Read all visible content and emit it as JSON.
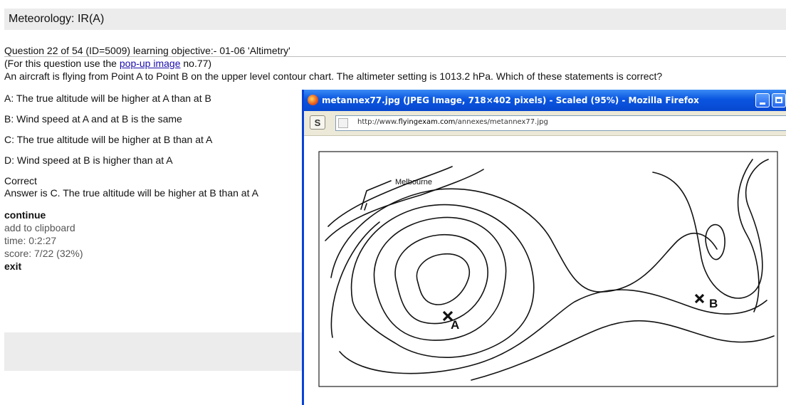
{
  "header": {
    "title": "Meteorology: IR(A)"
  },
  "question": {
    "meta": "Question 22 of 54 (ID=5009) learning objective:- 01-06 'Altimetry'",
    "popup_prefix": "(For this question use the ",
    "popup_link": "pop-up image",
    "popup_suffix": " no.77)",
    "text": "An aircraft is flying from Point A to Point B on the upper level contour chart. The altimeter setting is 1013.2 hPa. Which of these statements is correct?"
  },
  "answers": [
    "A: The true altitude will be higher at A than at B",
    "B: Wind speed at A and at B is the same",
    "C: The true altitude will be higher at B than at A",
    "D: Wind speed at B is higher than at A"
  ],
  "result": {
    "status": "Correct",
    "answer": "Answer is C. The true altitude will be higher at B than at A"
  },
  "controls": {
    "continue": "continue",
    "clipboard": "add to clipboard",
    "time": "time: 0:2:27",
    "score": "score: 7/22 (32%)",
    "exit": "exit"
  },
  "popup": {
    "title": "metannex77.jpg (JPEG Image, 718×402 pixels) - Scaled (95%) - Mozilla Firefox",
    "s_button": "S",
    "url_prefix": "http://www.",
    "url_domain": "flyingexam.com",
    "url_path": "/annexes/metannex77.jpg",
    "image": {
      "label_city": "Melbourne",
      "label_a": "A",
      "label_b": "B"
    }
  },
  "colors": {
    "titlebar_blue": "#0a55e0",
    "link": "#1a0dab",
    "panel_grey": "#ececec"
  },
  "icons": [
    "firefox-icon",
    "minimize-icon",
    "maximize-icon",
    "page-icon"
  ]
}
